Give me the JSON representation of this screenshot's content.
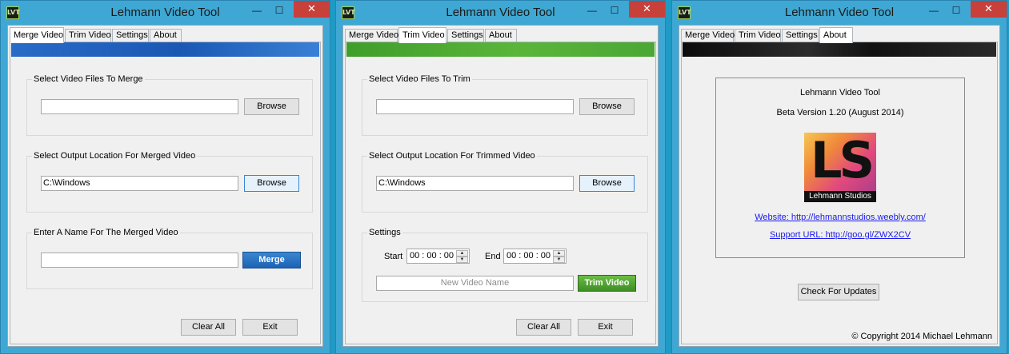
{
  "windows": [
    {
      "title": "Lehmann Video Tool",
      "tabs": [
        "Merge Video",
        "Trim Video",
        "Settings",
        "About"
      ],
      "active_tab": "Merge Video",
      "group1": {
        "label": "Select Video Files To Merge",
        "input": "",
        "button": "Browse"
      },
      "group2": {
        "label": "Select Output Location For Merged Video",
        "input": "C:\\Windows",
        "button": "Browse"
      },
      "group3": {
        "label": "Enter A Name For The Merged Video",
        "input": "",
        "button": "Merge"
      },
      "clear_all": "Clear All",
      "exit": "Exit"
    },
    {
      "title": "Lehmann Video Tool",
      "tabs": [
        "Merge Video",
        "Trim Video",
        "Settings",
        "About"
      ],
      "active_tab": "Trim Video",
      "group1": {
        "label": "Select Video Files To Trim",
        "input": "",
        "button": "Browse"
      },
      "group2": {
        "label": "Select Output Location For Trimmed Video",
        "input": "C:\\Windows",
        "button": "Browse"
      },
      "settings": {
        "label": "Settings",
        "start_label": "Start",
        "start_value": "00 : 00 : 00",
        "end_label": "End",
        "end_value": "00 : 00 : 00",
        "name_placeholder": "New Video Name",
        "button": "Trim Video"
      },
      "clear_all": "Clear All",
      "exit": "Exit"
    },
    {
      "title": "Lehmann Video Tool",
      "tabs": [
        "Merge Video",
        "Trim Video",
        "Settings",
        "About"
      ],
      "active_tab": "About",
      "about": {
        "app_name": "Lehmann Video Tool",
        "version": "Beta Version 1.20 (August 2014)",
        "logo_text": "LS",
        "logo_caption": "Lehmann Studios",
        "website": "Website: http://lehmannstudios.weebly.com/",
        "support": "Support URL: http://goo.gl/ZWX2CV",
        "check_updates": "Check For Updates",
        "copyright": "© Copyright 2014 Michael Lehmann"
      }
    }
  ],
  "titlebar": {
    "app_icon": "LVT",
    "minimize": "—",
    "maximize": "☐",
    "close": "✕"
  },
  "colors": {
    "merge_button": "#1c62b5",
    "trim_button": "#3d8f24",
    "close_button": "#c7403a"
  }
}
